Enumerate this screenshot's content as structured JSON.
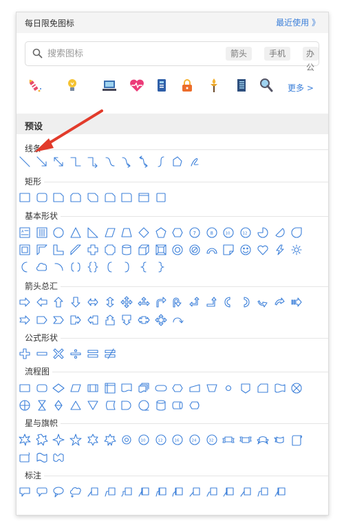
{
  "header": {
    "title": "每日限免图标",
    "recent_label": "最近使用 》"
  },
  "search": {
    "placeholder": "搜索图标",
    "tags": [
      "箭头",
      "手机",
      "办公"
    ]
  },
  "free_icons": [
    "firework-icon",
    "lightbulb-icon",
    "laptop-icon",
    "heart-pulse-icon",
    "phone-book-icon",
    "lock-icon",
    "torch-icon",
    "notebook-icon",
    "magnifier-icon"
  ],
  "more_label": "更多 >",
  "presets": {
    "title": "预设"
  },
  "categories": {
    "lines": "线条",
    "rect": "矩形",
    "basic": "基本形状",
    "arrows": "箭头总汇",
    "formula": "公式形状",
    "flowchart": "流程图",
    "stars": "星与旗帜",
    "callouts": "标注"
  },
  "colors": {
    "accent": "#3b7fd9",
    "shape_stroke": "#3b7fd9",
    "annotation_arrow": "#e23b2b"
  }
}
